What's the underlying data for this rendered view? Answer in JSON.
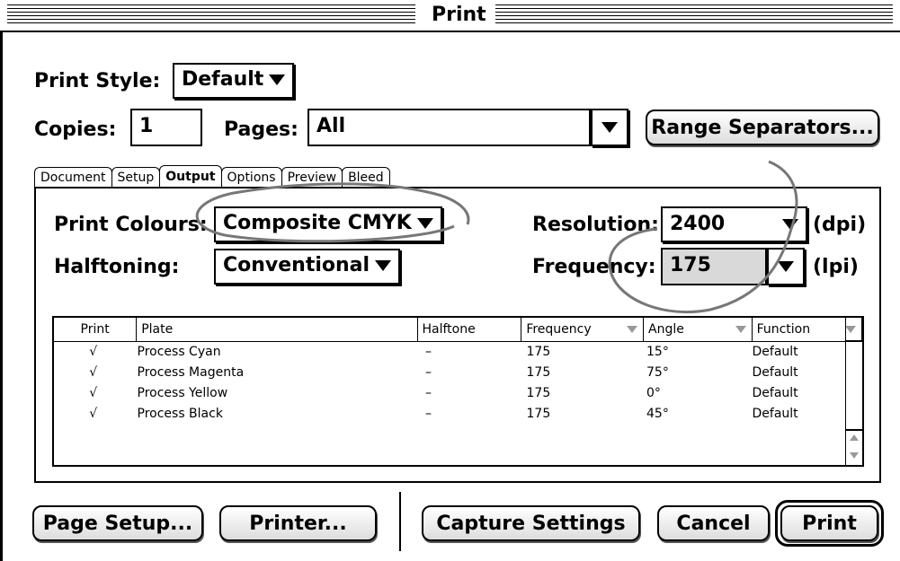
{
  "window": {
    "title": "Print"
  },
  "print_style": {
    "label": "Print Style:",
    "value": "Default"
  },
  "copies": {
    "label": "Copies:",
    "value": "1"
  },
  "pages": {
    "label": "Pages:",
    "value": "All"
  },
  "range_separators_button": "Range Separators...",
  "tabs": [
    {
      "label": "Document",
      "active": false
    },
    {
      "label": "Setup",
      "active": false
    },
    {
      "label": "Output",
      "active": true
    },
    {
      "label": "Options",
      "active": false
    },
    {
      "label": "Preview",
      "active": false
    },
    {
      "label": "Bleed",
      "active": false
    }
  ],
  "output": {
    "print_colours": {
      "label": "Print Colours:",
      "value": "Composite CMYK"
    },
    "halftoning": {
      "label": "Halftoning:",
      "value": "Conventional"
    },
    "resolution": {
      "label": "Resolution:",
      "value": "2400",
      "unit": "(dpi)"
    },
    "frequency": {
      "label": "Frequency:",
      "value": "175",
      "unit": "(lpi)"
    }
  },
  "plates_table": {
    "columns": [
      "Print",
      "Plate",
      "Halftone",
      "Frequency",
      "Angle",
      "Function"
    ],
    "rows": [
      {
        "print": "√",
        "plate": "Process Cyan",
        "halftone": "–",
        "frequency": "175",
        "angle": "15°",
        "function": "Default"
      },
      {
        "print": "√",
        "plate": "Process Magenta",
        "halftone": "–",
        "frequency": "175",
        "angle": "75°",
        "function": "Default"
      },
      {
        "print": "√",
        "plate": "Process Yellow",
        "halftone": "–",
        "frequency": "175",
        "angle": "0°",
        "function": "Default"
      },
      {
        "print": "√",
        "plate": "Process Black",
        "halftone": "–",
        "frequency": "175",
        "angle": "45°",
        "function": "Default"
      }
    ]
  },
  "buttons": {
    "page_setup": "Page Setup...",
    "printer": "Printer...",
    "capture_settings": "Capture Settings",
    "cancel": "Cancel",
    "print": "Print"
  },
  "icons": {
    "dropdown": "triangle-down-icon",
    "scroll_up": "scroll-up-arrow-icon",
    "scroll_down": "scroll-down-arrow-icon"
  }
}
